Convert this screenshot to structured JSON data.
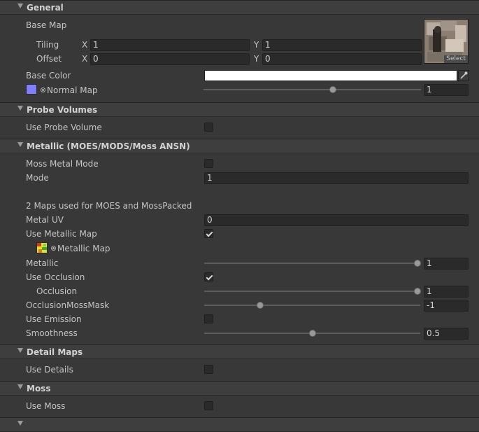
{
  "sections": {
    "general": "General",
    "probe_volumes": "Probe Volumes",
    "metallic": "Metallic (MOES/MODS/Moss ANSN)",
    "detail_maps": "Detail Maps",
    "moss": "Moss"
  },
  "general": {
    "base_map_label": "Base Map",
    "tiling_label": "Tiling",
    "offset_label": "Offset",
    "x_label": "X",
    "y_label": "Y",
    "tiling_x": "1",
    "tiling_y": "1",
    "offset_x": "0",
    "offset_y": "0",
    "select_label": "Select",
    "base_color_label": "Base Color",
    "base_color_value": "#ffffff",
    "normal_map_label": "Normal Map",
    "normal_map_swatch": "#8080ff",
    "normal_map_value": "1",
    "normal_map_fraction": 0.6
  },
  "probe": {
    "use_probe_volume_label": "Use Probe Volume",
    "use_probe_volume_checked": false
  },
  "metallic": {
    "moss_metal_mode_label": "Moss Metal Mode",
    "moss_metal_mode_checked": false,
    "mode_label": "Mode",
    "mode_value": "1",
    "maps_info": "2 Maps used for MOES and MossPacked",
    "metal_uv_label": "Metal UV",
    "metal_uv_value": "0",
    "use_metallic_map_label": "Use Metallic Map",
    "use_metallic_map_checked": true,
    "metallic_map_label": "Metallic Map",
    "metallic_label": "Metallic",
    "metallic_value": "1",
    "use_occlusion_label": "Use Occlusion",
    "use_occlusion_checked": true,
    "occlusion_label": "Occlusion",
    "occlusion_value": "1",
    "occlusion_moss_mask_label": "OcclusionMossMask",
    "occlusion_moss_mask_value": "-1",
    "use_emission_label": "Use Emission",
    "use_emission_checked": false,
    "smoothness_label": "Smoothness",
    "smoothness_value": "0.5"
  },
  "detail": {
    "use_details_label": "Use Details",
    "use_details_checked": false
  },
  "moss": {
    "use_moss_label": "Use Moss",
    "use_moss_checked": false
  }
}
